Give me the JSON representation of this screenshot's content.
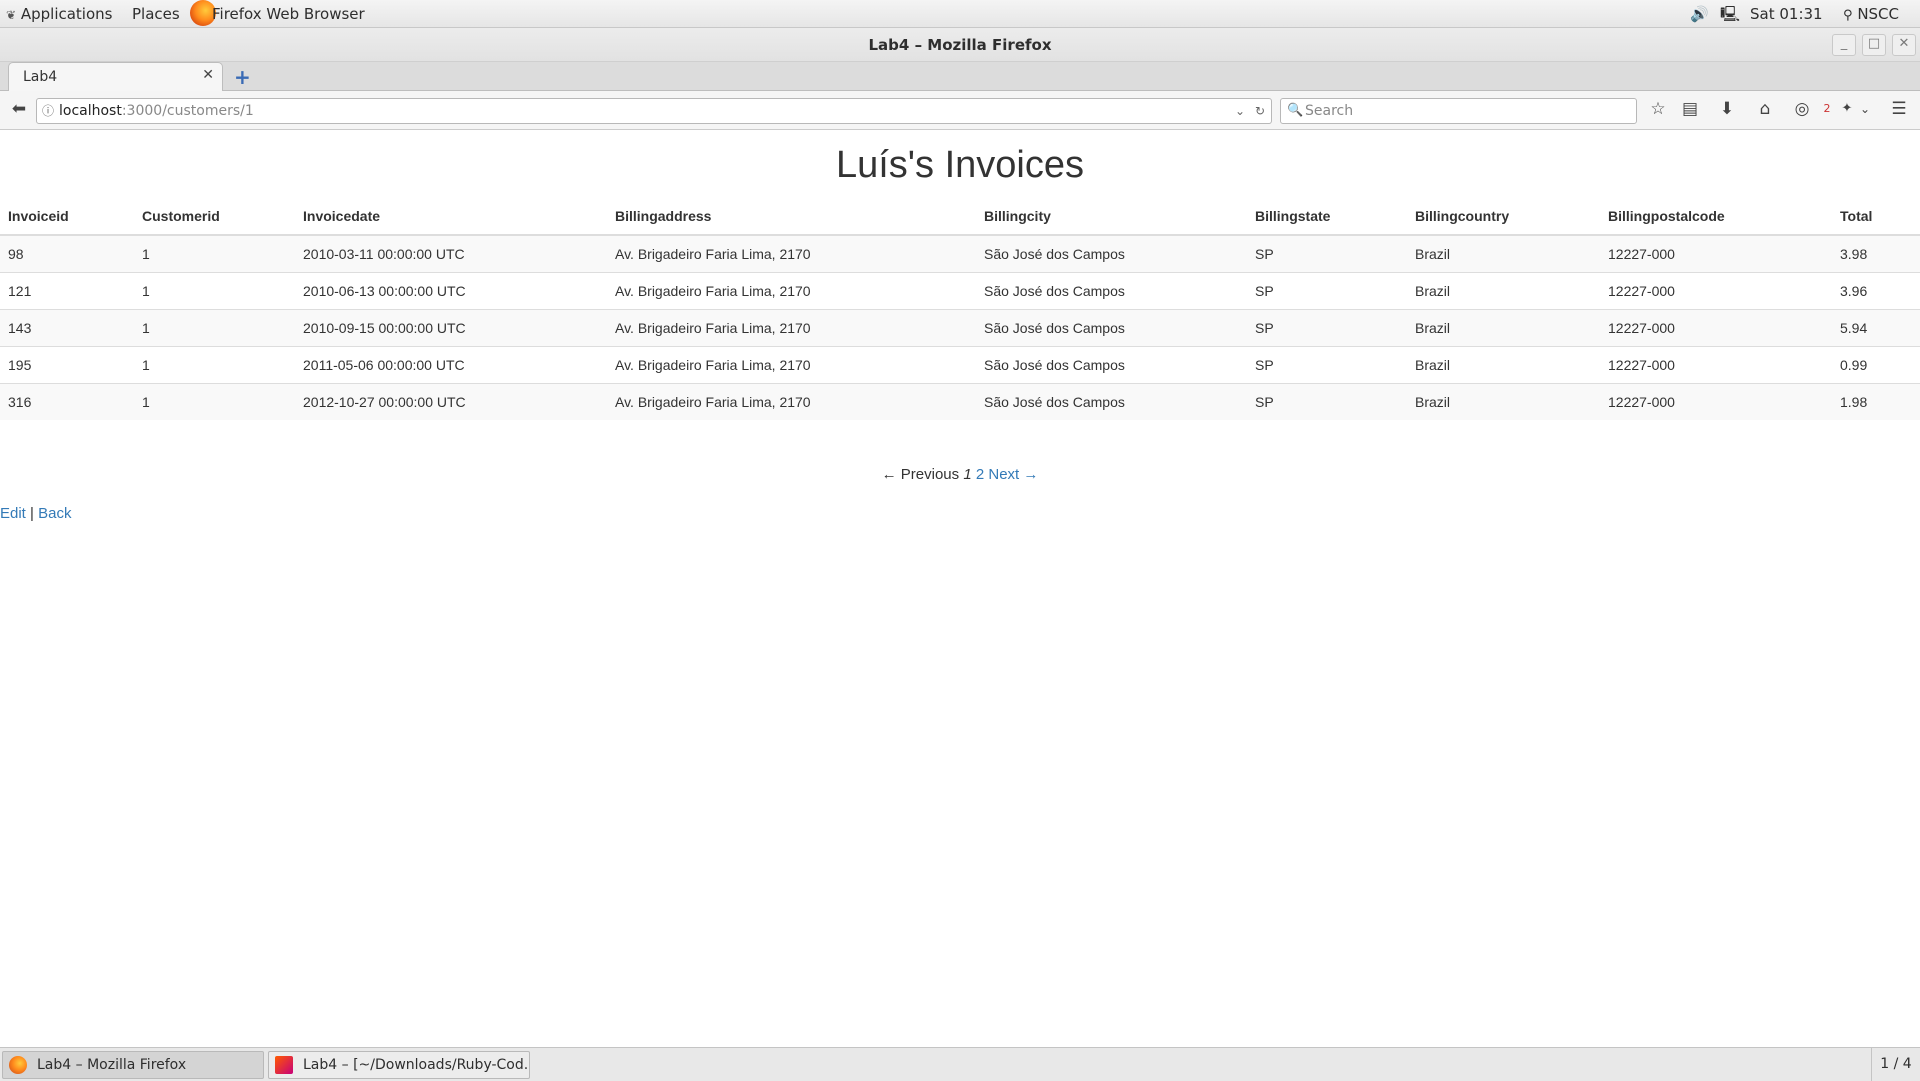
{
  "top_panel": {
    "applications": "Applications",
    "places": "Places",
    "active_app": "Firefox Web Browser",
    "clock": "Sat 01:31",
    "user": "NSCC"
  },
  "window": {
    "title": "Lab4 – Mozilla Firefox"
  },
  "tabs": [
    {
      "label": "Lab4"
    }
  ],
  "navbar": {
    "url_host": "localhost",
    "url_path": ":3000/customers/1",
    "search_placeholder": "Search",
    "badge_count": "2"
  },
  "page": {
    "heading": "Luís's Invoices",
    "columns": [
      "Invoiceid",
      "Customerid",
      "Invoicedate",
      "Billingaddress",
      "Billingcity",
      "Billingstate",
      "Billingcountry",
      "Billingpostalcode",
      "Total"
    ],
    "rows": [
      [
        "98",
        "1",
        "2010-03-11 00:00:00 UTC",
        "Av. Brigadeiro Faria Lima, 2170",
        "São José dos Campos",
        "SP",
        "Brazil",
        "12227-000",
        "3.98"
      ],
      [
        "121",
        "1",
        "2010-06-13 00:00:00 UTC",
        "Av. Brigadeiro Faria Lima, 2170",
        "São José dos Campos",
        "SP",
        "Brazil",
        "12227-000",
        "3.96"
      ],
      [
        "143",
        "1",
        "2010-09-15 00:00:00 UTC",
        "Av. Brigadeiro Faria Lima, 2170",
        "São José dos Campos",
        "SP",
        "Brazil",
        "12227-000",
        "5.94"
      ],
      [
        "195",
        "1",
        "2011-05-06 00:00:00 UTC",
        "Av. Brigadeiro Faria Lima, 2170",
        "São José dos Campos",
        "SP",
        "Brazil",
        "12227-000",
        "0.99"
      ],
      [
        "316",
        "1",
        "2012-10-27 00:00:00 UTC",
        "Av. Brigadeiro Faria Lima, 2170",
        "São José dos Campos",
        "SP",
        "Brazil",
        "12227-000",
        "1.98"
      ]
    ],
    "pagination": {
      "previous": "← Previous",
      "current": "1",
      "page2": "2",
      "next": "Next →"
    },
    "links": {
      "edit": "Edit",
      "separator": "|",
      "back": "Back"
    }
  },
  "taskbar": {
    "items": [
      {
        "label": "Lab4 – Mozilla Firefox"
      },
      {
        "label": "Lab4 – [~/Downloads/Ruby-Cod..."
      }
    ],
    "workspace": "1 / 4"
  },
  "colors": {
    "link": "#337ab7",
    "row_stripe": "#f9f9f9",
    "panel": "#e8e8e8"
  }
}
